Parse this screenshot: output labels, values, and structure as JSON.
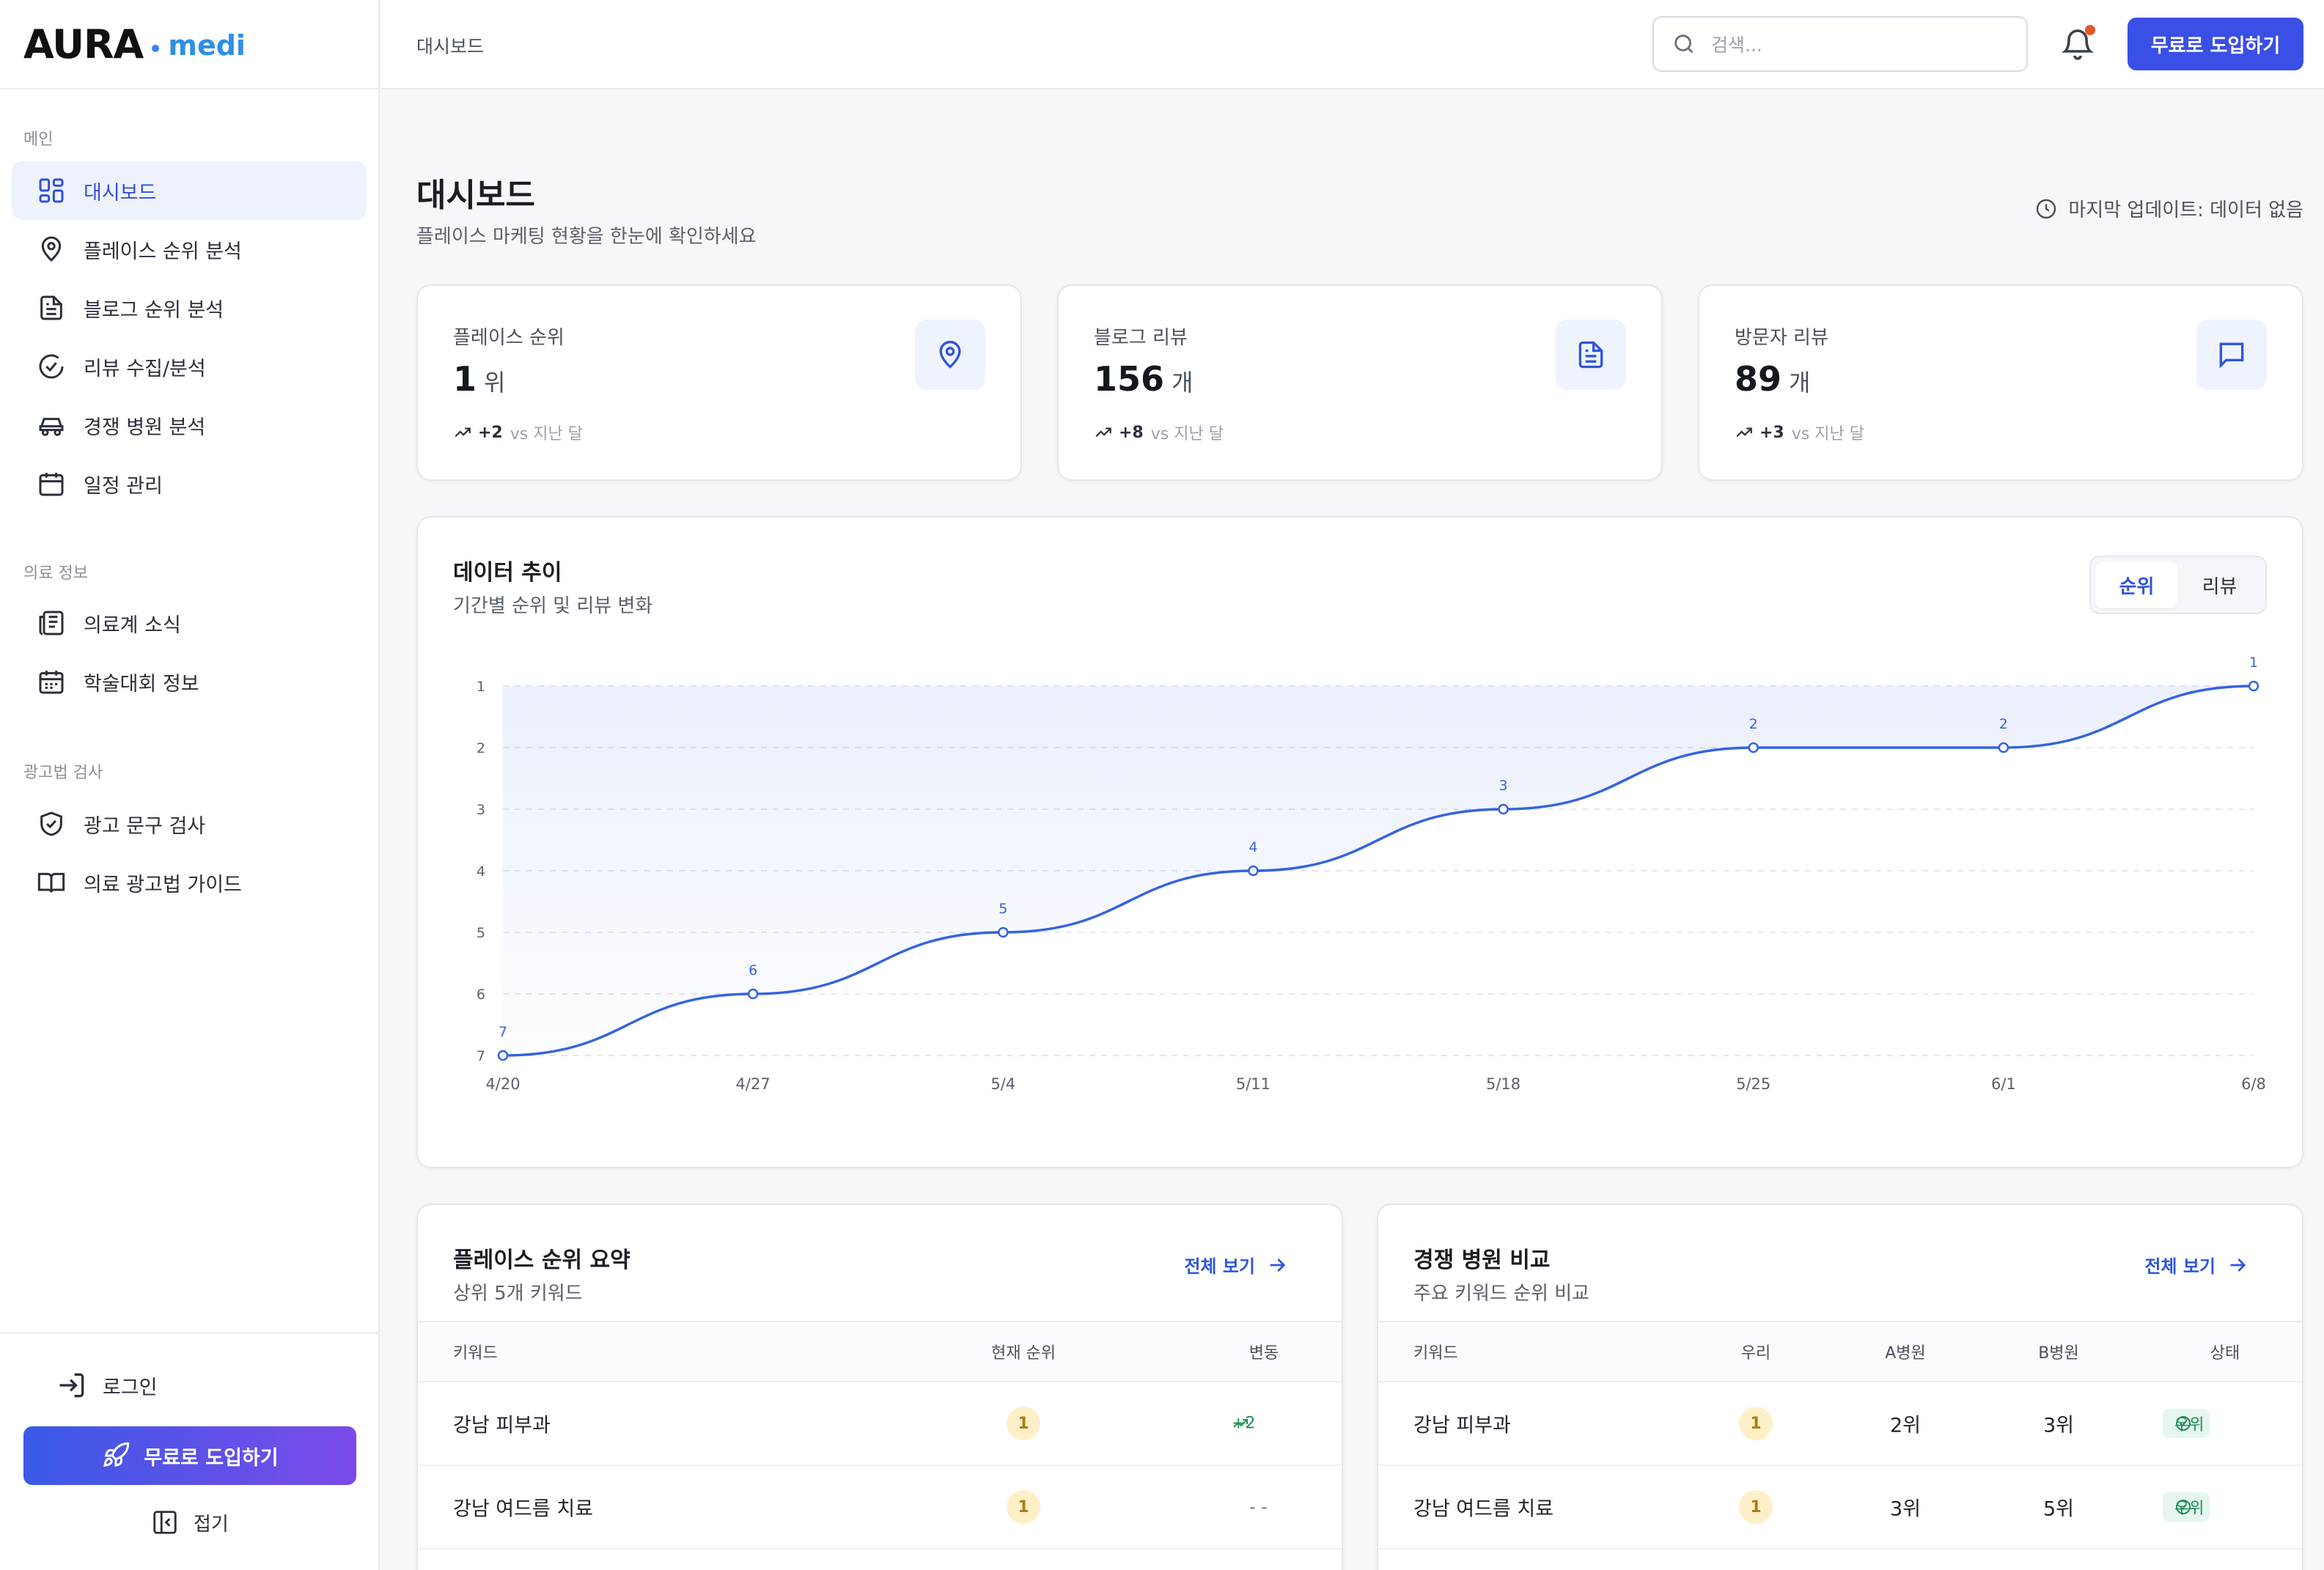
{
  "brand": {
    "name": "AURA",
    "sub": "medi"
  },
  "sidebar": {
    "sections": [
      {
        "title": "메인"
      },
      {
        "title": "의료 정보"
      },
      {
        "title": "광고법 검사"
      }
    ],
    "items": [
      {
        "label": "대시보드",
        "icon": "dashboard-icon"
      },
      {
        "label": "플레이스 순위 분석",
        "icon": "map-pin-icon"
      },
      {
        "label": "블로그 순위 분석",
        "icon": "document-icon"
      },
      {
        "label": "리뷰 수집/분석",
        "icon": "check-circle-icon"
      },
      {
        "label": "경쟁 병원 분석",
        "icon": "car-icon"
      },
      {
        "label": "일정 관리",
        "icon": "calendar-icon"
      },
      {
        "label": "의료계 소식",
        "icon": "newspaper-icon"
      },
      {
        "label": "학술대회 정보",
        "icon": "calendar-grid-icon"
      },
      {
        "label": "광고 문구 검사",
        "icon": "shield-check-icon"
      },
      {
        "label": "의료 광고법 가이드",
        "icon": "book-icon"
      }
    ],
    "login_label": "로그인",
    "cta_label": "무료로 도입하기",
    "collapse_label": "접기"
  },
  "topbar": {
    "breadcrumb": "대시보드",
    "search_placeholder": "검색...",
    "cta_label": "무료로 도입하기"
  },
  "page": {
    "title": "대시보드",
    "subtitle": "플레이스 마케팅 현황을 한눈에 확인하세요",
    "last_updated": "마지막 업데이트: 데이터 없음"
  },
  "stats": [
    {
      "label": "플레이스 순위",
      "value": "1",
      "unit": "위",
      "delta": "+2",
      "vs": "vs 지난 달",
      "icon": "map-pin-icon"
    },
    {
      "label": "블로그 리뷰",
      "value": "156",
      "unit": "개",
      "delta": "+8",
      "vs": "vs 지난 달",
      "icon": "document-icon"
    },
    {
      "label": "방문자 리뷰",
      "value": "89",
      "unit": "개",
      "delta": "+3",
      "vs": "vs 지난 달",
      "icon": "chat-icon"
    }
  ],
  "trend": {
    "title": "데이터 추이",
    "subtitle": "기간별 순위 및 리뷰 변화",
    "tabs": [
      "순위",
      "리뷰"
    ],
    "active_tab": "순위"
  },
  "chart_data": {
    "type": "line",
    "x": [
      "4/20",
      "4/27",
      "5/4",
      "5/11",
      "5/18",
      "5/25",
      "6/1",
      "6/8"
    ],
    "series": [
      {
        "values": [
          7,
          6,
          5,
          4,
          3,
          2,
          2,
          1
        ]
      }
    ],
    "ylim": [
      7,
      1
    ],
    "yticks": [
      "1",
      "2",
      "3",
      "4",
      "5",
      "6",
      "7"
    ],
    "y_inverted": true,
    "grid": true,
    "area_fill": true,
    "color": "#3563e0"
  },
  "place_summary": {
    "title": "플레이스 순위 요약",
    "subtitle": "상위 5개 키워드",
    "view_all": "전체 보기",
    "columns": [
      "키워드",
      "현재 순위",
      "변동"
    ],
    "rows": [
      {
        "keyword": "강남 피부과",
        "rank": "1",
        "change": "+2"
      },
      {
        "keyword": "강남 여드름 치료",
        "rank": "1",
        "change": "- -"
      }
    ]
  },
  "competitor": {
    "title": "경쟁 병원 비교",
    "subtitle": "주요 키워드 순위 비교",
    "view_all": "전체 보기",
    "columns": [
      "키워드",
      "우리",
      "A병원",
      "B병원",
      "상태"
    ],
    "rows": [
      {
        "keyword": "강남 피부과",
        "ours": "1",
        "a": "2위",
        "b": "3위",
        "status": "우위"
      },
      {
        "keyword": "강남 여드름 치료",
        "ours": "1",
        "a": "3위",
        "b": "5위",
        "status": "우위"
      }
    ]
  }
}
